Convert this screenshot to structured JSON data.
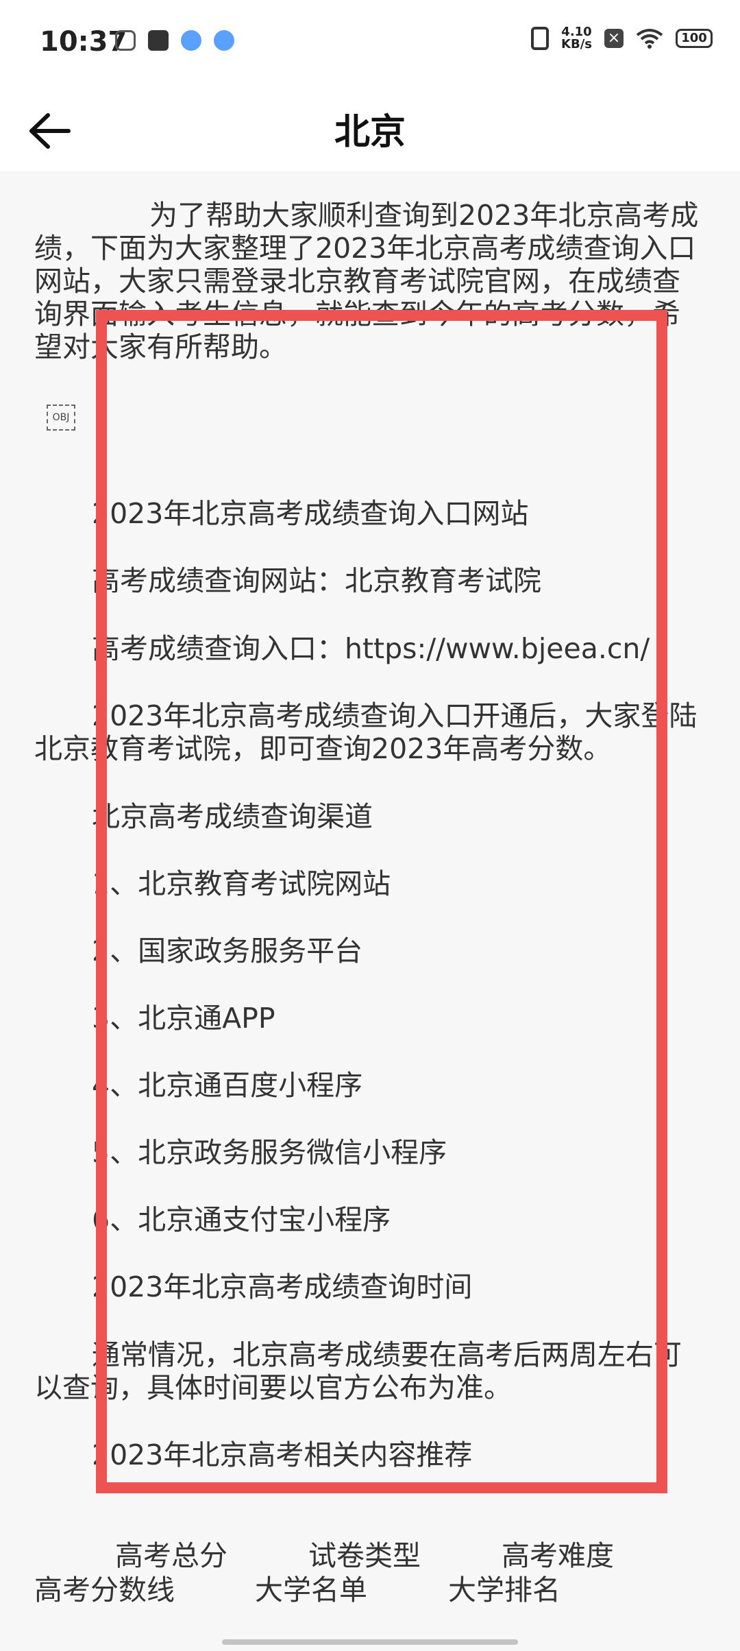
{
  "status_bar": {
    "time": "10:37",
    "net_speed_value": "4.10",
    "net_speed_unit": "KB/s",
    "battery": "100"
  },
  "app_bar": {
    "title": "北京"
  },
  "article": {
    "intro": "为了帮助大家顺利查询到2023年北京高考成绩，下面为大家整理了2023年北京高考成绩查询入口网站，大家只需登录北京教育考试院官网，在成绩查询界面输入考生信息，就能查到今年的高考分数，希望对大家有所帮助。",
    "obj_label": "OBJ",
    "lines": [
      "2023年北京高考成绩查询入口网站",
      "高考成绩查询网站：北京教育考试院",
      "高考成绩查询入口：https://www.bjeea.cn/",
      "2023年北京高考成绩查询入口开通后，大家登陆北京教育考试院，即可查询2023年高考分数。",
      "北京高考成绩查询渠道",
      "1、北京教育考试院网站",
      "2、国家政务服务平台",
      "3、北京通APP",
      "4、北京通百度小程序",
      "5、北京政务服务微信小程序",
      "6、北京通支付宝小程序",
      "2023年北京高考成绩查询时间",
      "通常情况，北京高考成绩要在高考后两周左右可以查询，具体时间要以官方公布为准。",
      "2023年北京高考相关内容推荐"
    ]
  },
  "footer_links": {
    "row1": [
      "高考总分",
      "试卷类型",
      "高考难度"
    ],
    "row2": [
      "高考分数线",
      "大学名单",
      "大学排名"
    ]
  },
  "colors": {
    "highlight": "#ee5351",
    "background": "#f7f7f7"
  }
}
